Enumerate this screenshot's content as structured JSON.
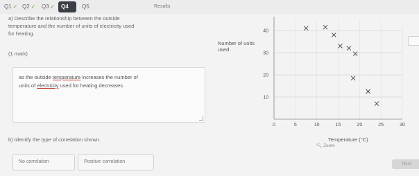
{
  "nav": {
    "tabs": [
      {
        "label": "Q1",
        "done": true
      },
      {
        "label": "Q2",
        "done": true
      },
      {
        "label": "Q3",
        "done": true
      },
      {
        "label": "Q4",
        "done": false,
        "active": true
      },
      {
        "label": "Q5",
        "done": false
      }
    ],
    "results_label": "Results",
    "tick_glyph": "✓"
  },
  "question": {
    "line1": "a)  Describe the relationship between the outside",
    "line2": "temperature and the number of units of electricity used",
    "line3": "for heating.",
    "marks": "(1 mark)",
    "answer": {
      "pre": "as the outside ",
      "word1": "temperature",
      "mid": " increases the number of",
      "pre2": "units of ",
      "word2": "electricity",
      "post2": " used for  heating decreases"
    },
    "part_b": "b)  Identify the type of correlation shown."
  },
  "choices": [
    "No correlation",
    "Positive correlation"
  ],
  "zoom_label": "Zoom",
  "next_label": "Next",
  "chart_data": {
    "type": "scatter",
    "ylabel": "Number of units used",
    "xlabel": "Temperature (°C)",
    "xlim": [
      0,
      30
    ],
    "ylim": [
      0,
      45
    ],
    "xticks": [
      0,
      5,
      10,
      15,
      20,
      25,
      30
    ],
    "yticks": [
      10,
      20,
      30,
      40
    ],
    "marker": "x",
    "grid": true,
    "points": [
      {
        "x": 7.5,
        "y": 41
      },
      {
        "x": 12,
        "y": 41.5
      },
      {
        "x": 14,
        "y": 38
      },
      {
        "x": 15.5,
        "y": 33
      },
      {
        "x": 17.5,
        "y": 32
      },
      {
        "x": 19,
        "y": 29.5
      },
      {
        "x": 18.5,
        "y": 18.5
      },
      {
        "x": 22,
        "y": 12.5
      },
      {
        "x": 24,
        "y": 7
      }
    ]
  }
}
